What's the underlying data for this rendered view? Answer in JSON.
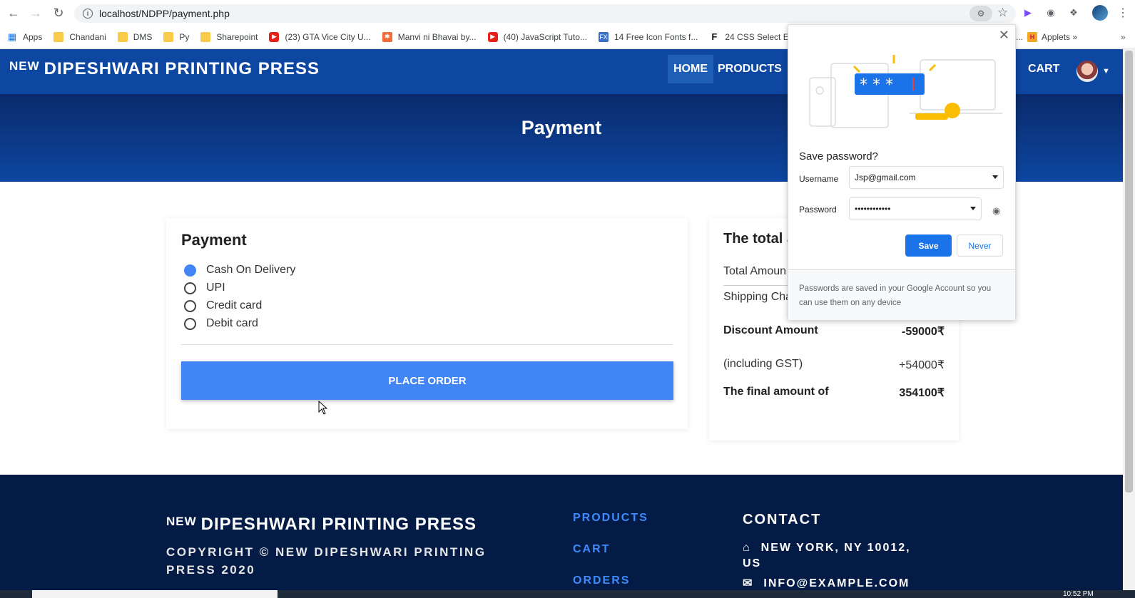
{
  "browser": {
    "url": "localhost/NDPP/payment.php",
    "bookmarks": [
      {
        "label": "Apps",
        "icon": "apps-grid-icon"
      },
      {
        "label": "Chandani",
        "icon": "folder-icon"
      },
      {
        "label": "DMS",
        "icon": "folder-icon"
      },
      {
        "label": "Py",
        "icon": "folder-icon"
      },
      {
        "label": "Sharepoint",
        "icon": "folder-icon"
      },
      {
        "label": "(23) GTA Vice City U...",
        "icon": "youtube-icon"
      },
      {
        "label": "Manvi ni Bhavai by...",
        "icon": "orange-site-icon"
      },
      {
        "label": "(40) JavaScript Tuto...",
        "icon": "youtube-icon"
      },
      {
        "label": "14 Free Icon Fonts f...",
        "icon": "fx-icon"
      },
      {
        "label": "24 CSS Select E",
        "icon": "f-icon"
      }
    ],
    "bookmark_right": {
      "prefix": "s...",
      "label": "Applets",
      "more": "»"
    }
  },
  "site": {
    "brand_prefix": "NEW",
    "brand_name": "DIPESHWARI PRINTING PRESS",
    "nav": [
      "HOME",
      "PRODUCTS",
      "S",
      "CART"
    ]
  },
  "hero": {
    "title": "Payment"
  },
  "payment": {
    "title": "Payment",
    "options": [
      {
        "label": "Cash On Delivery",
        "checked": true
      },
      {
        "label": "UPI",
        "checked": false
      },
      {
        "label": "Credit card",
        "checked": false
      },
      {
        "label": "Debit card",
        "checked": false
      }
    ],
    "place_order": "PLACE ORDER"
  },
  "totals": {
    "title": "The total a",
    "total_amount_label": "Total Amoun",
    "shipping_label": "Shipping Cha",
    "discount_label": "Discount Amount",
    "discount_value": "-59000₹",
    "gst_label": "(including GST)",
    "gst_value": "+54000₹",
    "final_label": "The final amount of",
    "final_value": "354100₹"
  },
  "footer": {
    "brand_prefix": "NEW",
    "brand_name": "DIPESHWARI PRINTING PRESS",
    "copyright": "COPYRIGHT © NEW DIPESHWARI PRINTING PRESS 2020",
    "links": [
      "PRODUCTS",
      "CART",
      "ORDERS"
    ],
    "contact_title": "CONTACT",
    "address": "NEW YORK, NY 10012, US",
    "email": "INFO@EXAMPLE.COM"
  },
  "password_popup": {
    "title": "Save password?",
    "username_label": "Username",
    "username_value": "Jsp@gmail.com",
    "password_label": "Password",
    "password_value": "••••••••••••",
    "save_label": "Save",
    "never_label": "Never",
    "footer_text": "Passwords are saved in your Google Account so you can use them on any device",
    "illustration_text": "* * *"
  },
  "taskbar": {
    "clock": "10:52 PM"
  },
  "colors": {
    "accent": "#4285f4",
    "nav": "#0d47a1",
    "footer": "#041c45",
    "chrome_blue": "#1a73e8"
  }
}
